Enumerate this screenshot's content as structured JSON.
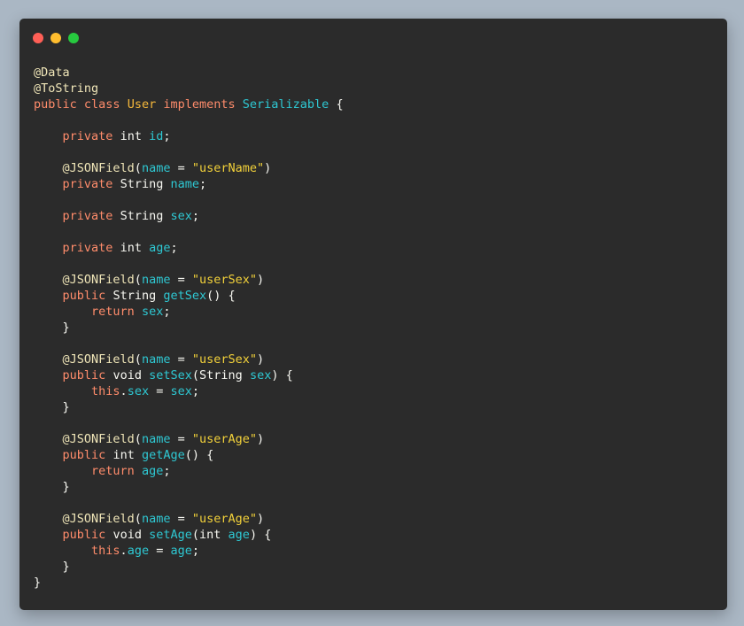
{
  "colors": {
    "background": "#aab7c4",
    "window": "#2b2b2b",
    "keyword": "#ff8c6b",
    "class_name": "#f5b83b",
    "interface_name": "#2ec8d3",
    "variable": "#2ec8d3",
    "annotation": "#f0e6b8",
    "string": "#f2d13a",
    "text": "#f8f8f2"
  },
  "window_controls": [
    "close-dot",
    "minimize-dot",
    "maximize-dot"
  ],
  "code_lines": [
    [
      {
        "t": "anno",
        "v": "@Data"
      }
    ],
    [
      {
        "t": "anno",
        "v": "@ToString"
      }
    ],
    [
      {
        "t": "kw",
        "v": "public"
      },
      {
        "t": "plain",
        "v": " "
      },
      {
        "t": "kw",
        "v": "class"
      },
      {
        "t": "plain",
        "v": " "
      },
      {
        "t": "cls",
        "v": "User"
      },
      {
        "t": "plain",
        "v": " "
      },
      {
        "t": "kw",
        "v": "implements"
      },
      {
        "t": "plain",
        "v": " "
      },
      {
        "t": "cls2",
        "v": "Serializable"
      },
      {
        "t": "plain",
        "v": " {"
      }
    ],
    [],
    [
      {
        "t": "plain",
        "v": "    "
      },
      {
        "t": "kw",
        "v": "private"
      },
      {
        "t": "plain",
        "v": " "
      },
      {
        "t": "type",
        "v": "int"
      },
      {
        "t": "plain",
        "v": " "
      },
      {
        "t": "var",
        "v": "id"
      },
      {
        "t": "plain",
        "v": ";"
      }
    ],
    [],
    [
      {
        "t": "plain",
        "v": "    "
      },
      {
        "t": "anno",
        "v": "@JSONField"
      },
      {
        "t": "plain",
        "v": "("
      },
      {
        "t": "var",
        "v": "name"
      },
      {
        "t": "plain",
        "v": " = "
      },
      {
        "t": "str",
        "v": "\"userName\""
      },
      {
        "t": "plain",
        "v": ")"
      }
    ],
    [
      {
        "t": "plain",
        "v": "    "
      },
      {
        "t": "kw",
        "v": "private"
      },
      {
        "t": "plain",
        "v": " "
      },
      {
        "t": "type",
        "v": "String"
      },
      {
        "t": "plain",
        "v": " "
      },
      {
        "t": "var",
        "v": "name"
      },
      {
        "t": "plain",
        "v": ";"
      }
    ],
    [],
    [
      {
        "t": "plain",
        "v": "    "
      },
      {
        "t": "kw",
        "v": "private"
      },
      {
        "t": "plain",
        "v": " "
      },
      {
        "t": "type",
        "v": "String"
      },
      {
        "t": "plain",
        "v": " "
      },
      {
        "t": "var",
        "v": "sex"
      },
      {
        "t": "plain",
        "v": ";"
      }
    ],
    [],
    [
      {
        "t": "plain",
        "v": "    "
      },
      {
        "t": "kw",
        "v": "private"
      },
      {
        "t": "plain",
        "v": " "
      },
      {
        "t": "type",
        "v": "int"
      },
      {
        "t": "plain",
        "v": " "
      },
      {
        "t": "var",
        "v": "age"
      },
      {
        "t": "plain",
        "v": ";"
      }
    ],
    [],
    [
      {
        "t": "plain",
        "v": "    "
      },
      {
        "t": "anno",
        "v": "@JSONField"
      },
      {
        "t": "plain",
        "v": "("
      },
      {
        "t": "var",
        "v": "name"
      },
      {
        "t": "plain",
        "v": " = "
      },
      {
        "t": "str",
        "v": "\"userSex\""
      },
      {
        "t": "plain",
        "v": ")"
      }
    ],
    [
      {
        "t": "plain",
        "v": "    "
      },
      {
        "t": "kw",
        "v": "public"
      },
      {
        "t": "plain",
        "v": " "
      },
      {
        "t": "type",
        "v": "String"
      },
      {
        "t": "plain",
        "v": " "
      },
      {
        "t": "var",
        "v": "getSex"
      },
      {
        "t": "plain",
        "v": "() {"
      }
    ],
    [
      {
        "t": "plain",
        "v": "        "
      },
      {
        "t": "kw",
        "v": "return"
      },
      {
        "t": "plain",
        "v": " "
      },
      {
        "t": "var",
        "v": "sex"
      },
      {
        "t": "plain",
        "v": ";"
      }
    ],
    [
      {
        "t": "plain",
        "v": "    }"
      }
    ],
    [],
    [
      {
        "t": "plain",
        "v": "    "
      },
      {
        "t": "anno",
        "v": "@JSONField"
      },
      {
        "t": "plain",
        "v": "("
      },
      {
        "t": "var",
        "v": "name"
      },
      {
        "t": "plain",
        "v": " = "
      },
      {
        "t": "str",
        "v": "\"userSex\""
      },
      {
        "t": "plain",
        "v": ")"
      }
    ],
    [
      {
        "t": "plain",
        "v": "    "
      },
      {
        "t": "kw",
        "v": "public"
      },
      {
        "t": "plain",
        "v": " "
      },
      {
        "t": "type",
        "v": "void"
      },
      {
        "t": "plain",
        "v": " "
      },
      {
        "t": "var",
        "v": "setSex"
      },
      {
        "t": "plain",
        "v": "("
      },
      {
        "t": "type",
        "v": "String"
      },
      {
        "t": "plain",
        "v": " "
      },
      {
        "t": "var",
        "v": "sex"
      },
      {
        "t": "plain",
        "v": ") {"
      }
    ],
    [
      {
        "t": "plain",
        "v": "        "
      },
      {
        "t": "kw",
        "v": "this"
      },
      {
        "t": "plain",
        "v": "."
      },
      {
        "t": "var",
        "v": "sex"
      },
      {
        "t": "plain",
        "v": " = "
      },
      {
        "t": "var",
        "v": "sex"
      },
      {
        "t": "plain",
        "v": ";"
      }
    ],
    [
      {
        "t": "plain",
        "v": "    }"
      }
    ],
    [],
    [
      {
        "t": "plain",
        "v": "    "
      },
      {
        "t": "anno",
        "v": "@JSONField"
      },
      {
        "t": "plain",
        "v": "("
      },
      {
        "t": "var",
        "v": "name"
      },
      {
        "t": "plain",
        "v": " = "
      },
      {
        "t": "str",
        "v": "\"userAge\""
      },
      {
        "t": "plain",
        "v": ")"
      }
    ],
    [
      {
        "t": "plain",
        "v": "    "
      },
      {
        "t": "kw",
        "v": "public"
      },
      {
        "t": "plain",
        "v": " "
      },
      {
        "t": "type",
        "v": "int"
      },
      {
        "t": "plain",
        "v": " "
      },
      {
        "t": "var",
        "v": "getAge"
      },
      {
        "t": "plain",
        "v": "() {"
      }
    ],
    [
      {
        "t": "plain",
        "v": "        "
      },
      {
        "t": "kw",
        "v": "return"
      },
      {
        "t": "plain",
        "v": " "
      },
      {
        "t": "var",
        "v": "age"
      },
      {
        "t": "plain",
        "v": ";"
      }
    ],
    [
      {
        "t": "plain",
        "v": "    }"
      }
    ],
    [],
    [
      {
        "t": "plain",
        "v": "    "
      },
      {
        "t": "anno",
        "v": "@JSONField"
      },
      {
        "t": "plain",
        "v": "("
      },
      {
        "t": "var",
        "v": "name"
      },
      {
        "t": "plain",
        "v": " = "
      },
      {
        "t": "str",
        "v": "\"userAge\""
      },
      {
        "t": "plain",
        "v": ")"
      }
    ],
    [
      {
        "t": "plain",
        "v": "    "
      },
      {
        "t": "kw",
        "v": "public"
      },
      {
        "t": "plain",
        "v": " "
      },
      {
        "t": "type",
        "v": "void"
      },
      {
        "t": "plain",
        "v": " "
      },
      {
        "t": "var",
        "v": "setAge"
      },
      {
        "t": "plain",
        "v": "("
      },
      {
        "t": "type",
        "v": "int"
      },
      {
        "t": "plain",
        "v": " "
      },
      {
        "t": "var",
        "v": "age"
      },
      {
        "t": "plain",
        "v": ") {"
      }
    ],
    [
      {
        "t": "plain",
        "v": "        "
      },
      {
        "t": "kw",
        "v": "this"
      },
      {
        "t": "plain",
        "v": "."
      },
      {
        "t": "var",
        "v": "age"
      },
      {
        "t": "plain",
        "v": " = "
      },
      {
        "t": "var",
        "v": "age"
      },
      {
        "t": "plain",
        "v": ";"
      }
    ],
    [
      {
        "t": "plain",
        "v": "    }"
      }
    ],
    [
      {
        "t": "plain",
        "v": "}"
      }
    ]
  ]
}
